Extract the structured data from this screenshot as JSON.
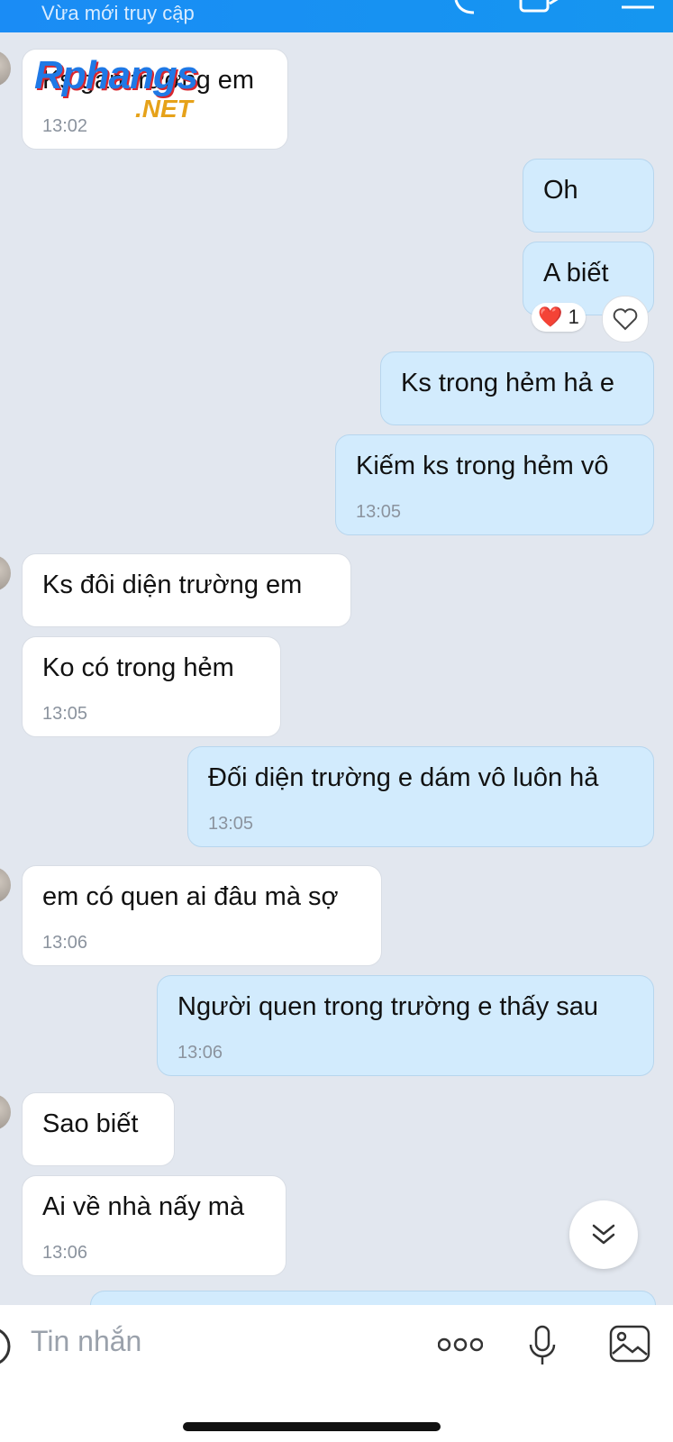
{
  "header": {
    "subtitle": "Vừa mới truy cập"
  },
  "watermark": {
    "brand": "Rphangs",
    "tld": ".NET"
  },
  "messages": [
    {
      "dir": "in",
      "text": "Ks gần trường em",
      "time": "13:02"
    },
    {
      "dir": "out",
      "text": "Oh"
    },
    {
      "dir": "out",
      "text": "A biết",
      "reaction": {
        "emoji": "❤️",
        "count": "1"
      }
    },
    {
      "dir": "out",
      "text": "Ks trong hẻm hả e"
    },
    {
      "dir": "out",
      "text": "Kiếm ks trong hẻm vô",
      "time": "13:05"
    },
    {
      "dir": "in",
      "text": "Ks đôi diện trường em"
    },
    {
      "dir": "in",
      "text": "Ko có trong hẻm",
      "time": "13:05"
    },
    {
      "dir": "out",
      "text": "Đối diện trường e dám vô luôn hả",
      "time": "13:05"
    },
    {
      "dir": "in",
      "text": "em có quen ai đâu mà sợ",
      "time": "13:06"
    },
    {
      "dir": "out",
      "text": "Người quen trong trường e thấy sau",
      "time": "13:06"
    },
    {
      "dir": "in",
      "text": "Sao biết"
    },
    {
      "dir": "in",
      "text": "Ai về nhà nấy mà",
      "time": "13:06"
    }
  ],
  "composer": {
    "placeholder": "Tin nhắn"
  },
  "icons": [
    "phone-icon",
    "video-icon",
    "menu-icon",
    "heart-icon",
    "double-chevron-down-icon",
    "sticker-icon",
    "more-icon",
    "mic-icon",
    "image-icon"
  ],
  "colors": {
    "header": "#1a8cf5",
    "outgoing_bubble": "#d2ebfd",
    "incoming_bubble": "#ffffff",
    "background": "#e2e7ef"
  }
}
